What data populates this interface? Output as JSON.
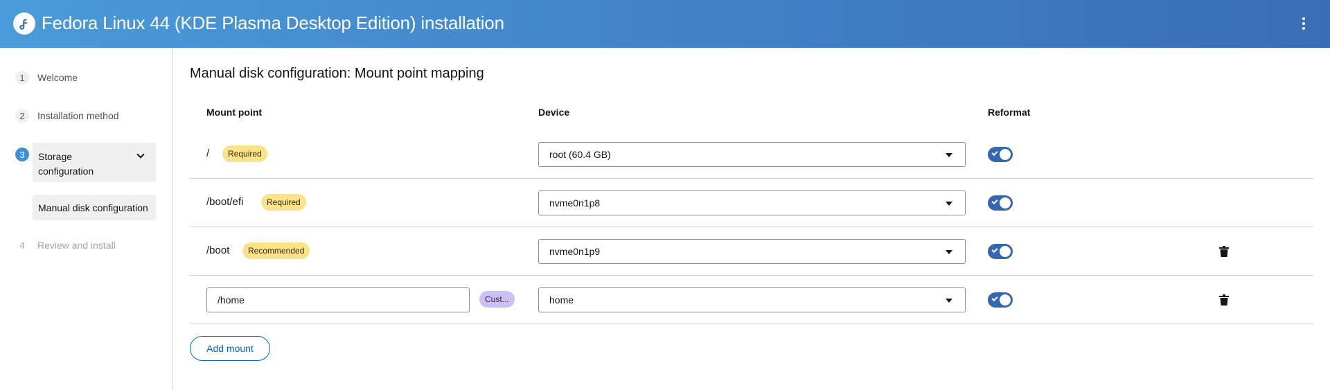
{
  "header": {
    "title": "Fedora Linux 44 (KDE Plasma Desktop Edition) installation",
    "logo_icon": "fedora-logo-icon",
    "menu_icon": "kebab-menu-icon"
  },
  "sidebar": {
    "items": [
      {
        "num": "1",
        "label": "Welcome"
      },
      {
        "num": "2",
        "label": "Installation method"
      },
      {
        "num": "3",
        "label": "Storage configuration"
      },
      {
        "num": "4",
        "label": "Review and install"
      }
    ],
    "subitem": "Manual disk configuration"
  },
  "main": {
    "title": "Manual disk configuration: Mount point mapping",
    "columns": {
      "mount_point": "Mount point",
      "device": "Device",
      "reformat": "Reformat"
    },
    "rows": [
      {
        "mount": "/",
        "badge": "Required",
        "device": "root (60.4 GB)",
        "reformat": true
      },
      {
        "mount": "/boot/efi",
        "badge": "Required",
        "device": "nvme0n1p8",
        "reformat": true
      },
      {
        "mount": "/boot",
        "badge": "Recommended",
        "device": "nvme0n1p9",
        "reformat": true
      },
      {
        "mount": "/home",
        "badge": "Cust...",
        "device": "home",
        "reformat": true
      }
    ],
    "add_button": "Add mount"
  },
  "colors": {
    "accent": "#3566b0",
    "required_badge": "#fbe38b",
    "custom_badge": "#cdbff1",
    "link": "#0066cc"
  }
}
